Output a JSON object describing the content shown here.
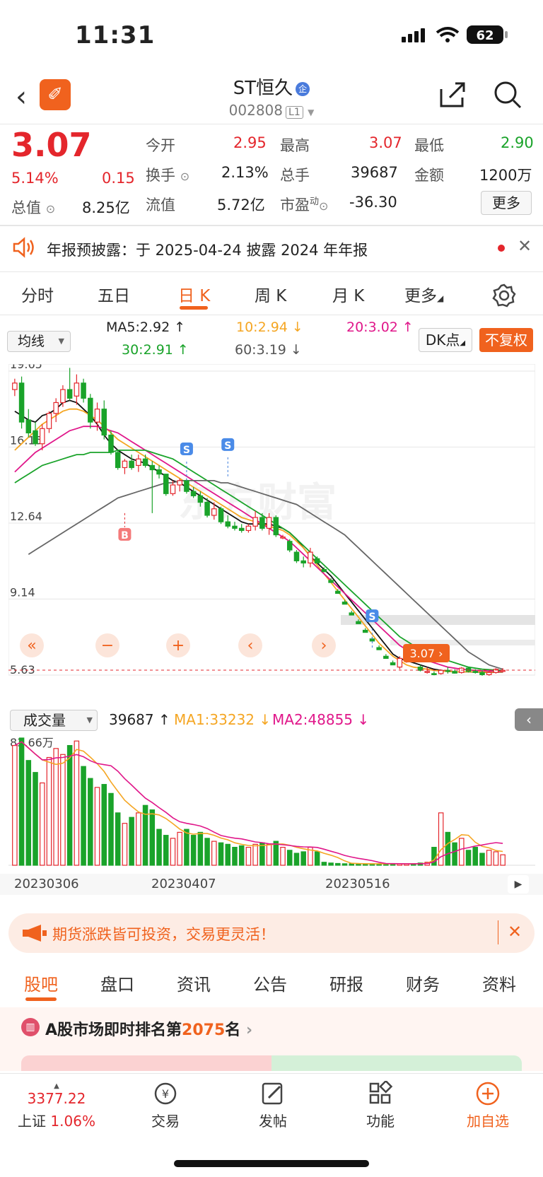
{
  "status": {
    "time": "11:31",
    "battery": "62"
  },
  "nav": {
    "title": "ST恒久",
    "badge": "企",
    "code": "002808",
    "level": "L1"
  },
  "quote": {
    "price": "3.07",
    "pct": "5.14%",
    "chg": "0.15",
    "open_label": "今开",
    "open": "2.95",
    "high_label": "最高",
    "high": "3.07",
    "low_label": "最低",
    "low": "2.90",
    "turnover_label": "换手",
    "turnover": "2.13%",
    "vol_label": "总手",
    "vol": "39687",
    "amount_label": "金额",
    "amount": "1200万",
    "mcap_label": "总值",
    "mcap": "8.25亿",
    "float_label": "流值",
    "float": "5.72亿",
    "pe_label": "市盈",
    "pe_sup": "动",
    "pe": "-36.30",
    "more": "更多"
  },
  "notice": {
    "text": "年报预披露：于 2025-04-24 披露 2024 年年报"
  },
  "tabs": [
    "分时",
    "五日",
    "日 K",
    "周 K",
    "月 K",
    "更多"
  ],
  "ma": {
    "select": "均线",
    "ma5": "MA5:2.92 ↑",
    "ma10": "10:2.94 ↓",
    "ma20": "20:3.02 ↑",
    "ma30": "30:2.91 ↑",
    "ma60": "60:3.19 ↓",
    "dk": "DK点",
    "fuquan": "不复权"
  },
  "chart_data": {
    "type": "candlestick",
    "y_ticks": [
      "19.65",
      "16.15",
      "12.64",
      "9.14",
      "5.63"
    ],
    "ylim": [
      5.63,
      19.65
    ],
    "current_price_tag": "3.07",
    "markers": [
      "B",
      "S",
      "S",
      "S"
    ],
    "watermark": "东方财富",
    "controls": [
      "«",
      "−",
      "+",
      "‹",
      "›"
    ],
    "candles": [
      [
        18.8,
        19.3,
        18.5,
        19.1
      ],
      [
        19.1,
        19.4,
        17.0,
        17.3
      ],
      [
        17.4,
        17.9,
        16.6,
        16.8
      ],
      [
        16.9,
        17.3,
        16.2,
        16.3
      ],
      [
        16.3,
        17.2,
        16.0,
        17.0
      ],
      [
        17.0,
        17.8,
        16.8,
        17.7
      ],
      [
        17.7,
        18.4,
        17.3,
        18.2
      ],
      [
        18.2,
        19.0,
        18.0,
        18.8
      ],
      [
        18.8,
        19.8,
        18.3,
        18.4
      ],
      [
        18.5,
        19.5,
        18.1,
        19.1
      ],
      [
        19.1,
        19.3,
        18.2,
        18.4
      ],
      [
        18.4,
        18.6,
        17.0,
        17.3
      ],
      [
        17.3,
        18.2,
        16.9,
        17.9
      ],
      [
        17.9,
        18.3,
        16.5,
        16.7
      ],
      [
        16.7,
        16.9,
        15.8,
        15.9
      ],
      [
        15.9,
        16.0,
        15.1,
        15.2
      ],
      [
        15.2,
        15.6,
        14.9,
        15.5
      ],
      [
        15.5,
        15.8,
        15.1,
        15.2
      ],
      [
        15.3,
        15.8,
        15.0,
        15.6
      ],
      [
        15.6,
        15.8,
        15.2,
        15.3
      ],
      [
        15.3,
        15.5,
        13.1,
        15.1
      ],
      [
        15.1,
        15.3,
        14.7,
        14.9
      ],
      [
        14.9,
        14.9,
        13.9,
        14.0
      ],
      [
        14.0,
        14.6,
        13.9,
        14.4
      ],
      [
        14.4,
        14.7,
        14.1,
        14.6
      ],
      [
        14.6,
        14.7,
        14.0,
        14.1
      ],
      [
        14.1,
        14.3,
        13.8,
        13.9
      ],
      [
        13.9,
        14.1,
        13.4,
        13.6
      ],
      [
        13.6,
        13.8,
        12.9,
        13.0
      ],
      [
        13.0,
        13.6,
        12.8,
        13.3
      ],
      [
        13.3,
        13.4,
        12.6,
        12.7
      ],
      [
        12.7,
        13.0,
        12.4,
        12.5
      ],
      [
        12.5,
        12.7,
        12.3,
        12.4
      ],
      [
        12.4,
        12.6,
        12.2,
        12.3
      ],
      [
        12.3,
        12.6,
        12.2,
        12.5
      ],
      [
        12.5,
        13.2,
        12.3,
        12.9
      ],
      [
        12.9,
        13.1,
        12.3,
        12.4
      ],
      [
        12.4,
        13.1,
        12.1,
        12.9
      ],
      [
        12.9,
        13.0,
        12.0,
        12.1
      ],
      [
        12.0,
        12.1,
        11.9,
        12.0
      ],
      [
        11.8,
        11.9,
        11.3,
        11.4
      ],
      [
        11.3,
        11.4,
        10.8,
        10.9
      ],
      [
        10.9,
        11.1,
        10.6,
        10.8
      ],
      [
        10.8,
        11.5,
        10.6,
        11.3
      ],
      [
        11.0,
        11.1,
        10.8,
        10.8
      ],
      [
        10.5,
        10.6,
        10.4,
        10.4
      ],
      [
        10.0,
        10.1,
        9.9,
        9.9
      ],
      [
        9.5,
        9.6,
        9.4,
        9.4
      ],
      [
        9.0,
        9.1,
        8.9,
        8.9
      ],
      [
        8.5,
        8.6,
        8.4,
        8.4
      ],
      [
        8.1,
        8.2,
        8.0,
        8.0
      ],
      [
        7.7,
        7.8,
        7.6,
        7.6
      ],
      [
        7.3,
        7.4,
        7.2,
        7.2
      ],
      [
        6.9,
        7.0,
        6.8,
        6.8
      ],
      [
        6.5,
        6.6,
        6.4,
        6.4
      ],
      [
        6.2,
        6.3,
        6.1,
        6.1
      ],
      [
        6.0,
        6.5,
        5.9,
        6.4
      ],
      [
        6.4,
        6.9,
        6.2,
        6.8
      ],
      [
        6.6,
        6.7,
        6.3,
        6.3
      ],
      [
        6.0,
        6.1,
        5.8,
        5.85
      ],
      [
        5.8,
        6.0,
        5.7,
        5.8
      ],
      [
        5.7,
        5.8,
        5.62,
        5.65
      ],
      [
        5.7,
        5.9,
        5.65,
        5.85
      ],
      [
        5.85,
        6.0,
        5.7,
        5.8
      ],
      [
        5.8,
        5.9,
        5.7,
        5.72
      ],
      [
        5.75,
        6.0,
        5.7,
        5.95
      ],
      [
        5.95,
        6.0,
        5.75,
        5.8
      ],
      [
        5.8,
        5.9,
        5.7,
        5.75
      ],
      [
        5.75,
        5.85,
        5.6,
        5.65
      ],
      [
        5.65,
        5.8,
        5.6,
        5.75
      ],
      [
        5.75,
        5.95,
        5.7,
        5.9
      ],
      [
        5.85,
        5.95,
        5.75,
        5.85
      ]
    ],
    "ma_series": [
      {
        "name": "MA5",
        "color": "#111111",
        "values": [
          17.8,
          17.6,
          17.4,
          17.3,
          17.6,
          17.7,
          17.9,
          18.2,
          18.3,
          18.2,
          17.9,
          17.6,
          17.2,
          16.7,
          16.3,
          16.0,
          15.8,
          15.6,
          15.5,
          15.4,
          15.2,
          15.0,
          14.8,
          14.6,
          14.5,
          14.3,
          14.1,
          13.9,
          13.7,
          13.5,
          13.3,
          13.1,
          12.9,
          12.7,
          12.6,
          12.6,
          12.6,
          12.6,
          12.5,
          12.4,
          12.2,
          11.9,
          11.5,
          11.1,
          10.8,
          10.5,
          10.2,
          9.8,
          9.4,
          9.0,
          8.6,
          8.2,
          7.8,
          7.4,
          7.0,
          6.6,
          6.4,
          6.3,
          6.2,
          6.1,
          6.0,
          5.9,
          5.85,
          5.8,
          5.78,
          5.78,
          5.78,
          5.77,
          5.76,
          5.75,
          5.76,
          5.77
        ]
      },
      {
        "name": "MA10",
        "color": "#f5a623",
        "values": [
          16.0,
          16.3,
          16.6,
          16.9,
          17.2,
          17.4,
          17.6,
          17.8,
          17.9,
          17.9,
          17.8,
          17.6,
          17.4,
          17.1,
          16.8,
          16.5,
          16.3,
          16.1,
          15.9,
          15.7,
          15.5,
          15.3,
          15.1,
          14.9,
          14.7,
          14.5,
          14.3,
          14.1,
          13.9,
          13.7,
          13.5,
          13.3,
          13.1,
          12.9,
          12.8,
          12.7,
          12.6,
          12.5,
          12.4,
          12.3,
          12.1,
          11.8,
          11.5,
          11.1,
          10.7,
          10.3,
          9.9,
          9.5,
          9.1,
          8.7,
          8.3,
          7.9,
          7.5,
          7.1,
          6.8,
          6.5,
          6.3,
          6.1,
          6.0,
          5.95,
          5.9,
          5.85,
          5.82,
          5.8,
          5.78,
          5.78,
          5.78,
          5.78,
          5.77,
          5.76,
          5.77,
          5.78
        ]
      },
      {
        "name": "MA20",
        "color": "#e0178a",
        "values": [
          15.0,
          15.3,
          15.6,
          15.9,
          16.1,
          16.3,
          16.5,
          16.7,
          16.9,
          17.0,
          17.1,
          17.1,
          17.1,
          17.0,
          16.9,
          16.8,
          16.6,
          16.4,
          16.2,
          16.0,
          15.8,
          15.6,
          15.4,
          15.2,
          15.0,
          14.8,
          14.6,
          14.4,
          14.2,
          14.0,
          13.8,
          13.6,
          13.4,
          13.2,
          13.0,
          12.8,
          12.6,
          12.4,
          12.2,
          12.0,
          11.8,
          11.5,
          11.2,
          10.9,
          10.6,
          10.3,
          10.0,
          9.7,
          9.4,
          9.1,
          8.8,
          8.5,
          8.2,
          7.9,
          7.6,
          7.3,
          7.0,
          6.8,
          6.6,
          6.4,
          6.3,
          6.2,
          6.1,
          6.0,
          5.95,
          5.9,
          5.87,
          5.85,
          5.83,
          5.82,
          5.81,
          5.8
        ]
      },
      {
        "name": "MA30",
        "color": "#1aa32a",
        "values": [
          14.5,
          14.7,
          14.9,
          15.1,
          15.3,
          15.4,
          15.5,
          15.6,
          15.7,
          15.8,
          15.8,
          15.9,
          15.9,
          15.9,
          15.9,
          16.0,
          16.0,
          16.0,
          16.0,
          16.0,
          15.9,
          15.8,
          15.7,
          15.6,
          15.4,
          15.2,
          15.0,
          14.8,
          14.6,
          14.4,
          14.2,
          14.0,
          13.8,
          13.6,
          13.4,
          13.2,
          13.0,
          12.8,
          12.6,
          12.4,
          12.2,
          11.9,
          11.6,
          11.3,
          11.0,
          10.7,
          10.4,
          10.1,
          9.8,
          9.5,
          9.2,
          8.9,
          8.6,
          8.3,
          8.0,
          7.7,
          7.4,
          7.2,
          7.0,
          6.8,
          6.6,
          6.5,
          6.4,
          6.3,
          6.2,
          6.1,
          6.0,
          5.95,
          5.9,
          5.88,
          5.86,
          5.85
        ]
      },
      {
        "name": "MA60",
        "color": "#666666",
        "values": [
          null,
          null,
          11.2,
          11.4,
          11.6,
          11.8,
          12.0,
          12.2,
          12.4,
          12.6,
          12.8,
          13.0,
          13.2,
          13.4,
          13.6,
          13.8,
          13.9,
          14.0,
          14.1,
          14.2,
          14.3,
          14.4,
          14.5,
          14.5,
          14.6,
          14.6,
          14.6,
          14.6,
          14.6,
          14.6,
          14.5,
          14.5,
          14.4,
          14.3,
          14.2,
          14.1,
          14.0,
          13.9,
          13.8,
          13.7,
          13.6,
          13.5,
          13.3,
          13.1,
          12.9,
          12.7,
          12.5,
          12.3,
          12.1,
          11.8,
          11.5,
          11.2,
          10.9,
          10.6,
          10.3,
          10.0,
          9.7,
          9.4,
          9.1,
          8.8,
          8.5,
          8.2,
          7.9,
          7.6,
          7.3,
          7.0,
          6.7,
          6.5,
          6.3,
          6.1,
          6.0,
          5.9
        ]
      }
    ],
    "volume": {
      "label": "成交量",
      "current": "39687 ↑",
      "ma1": "MA1:33232 ↓",
      "ma2": "MA2:48855 ↓",
      "ymax": "83.66万",
      "values": [
        80,
        85,
        70,
        62,
        55,
        72,
        78,
        74,
        80,
        83,
        66,
        58,
        52,
        54,
        48,
        35,
        28,
        32,
        35,
        40,
        37,
        24,
        20,
        18,
        22,
        24,
        20,
        22,
        18,
        16,
        15,
        14,
        12,
        13,
        12,
        14,
        15,
        14,
        16,
        12,
        10,
        8,
        9,
        12,
        9,
        2,
        1.5,
        1.2,
        1,
        1,
        1,
        1,
        1,
        1,
        1,
        1,
        1,
        1,
        1,
        1.5,
        2,
        12,
        35,
        22,
        15,
        18,
        10,
        12,
        8,
        10,
        9,
        7
      ]
    },
    "x_labels": [
      "20230306",
      "20230407",
      "20230516"
    ]
  },
  "promo": {
    "text": "期货涨跌皆可投资，交易更灵活！"
  },
  "bottom_tabs": [
    "股吧",
    "盘口",
    "资讯",
    "公告",
    "研报",
    "财务",
    "资料"
  ],
  "rank": {
    "prefix": "A股市场即时排名第",
    "num": "2075",
    "suffix": "名"
  },
  "bottombar": {
    "index_val": "3377.22",
    "index_name": "上证",
    "index_pct": "1.06%",
    "items": [
      "交易",
      "发帖",
      "功能",
      "加自选"
    ]
  }
}
